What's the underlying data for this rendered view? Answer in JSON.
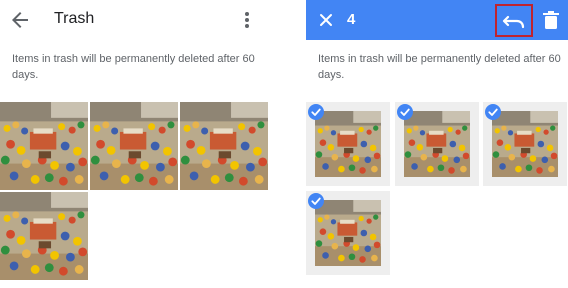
{
  "left": {
    "title": "Trash",
    "info": "Items in trash will be permanently deleted after 60 days.",
    "icons": {
      "back": "arrow-back-icon",
      "more": "more-vert-icon"
    },
    "photos": [
      {
        "name": "photo-1"
      },
      {
        "name": "photo-2"
      },
      {
        "name": "photo-3"
      },
      {
        "name": "photo-4"
      }
    ]
  },
  "right": {
    "selected_count": "4",
    "info": "Items in trash will be permanently deleted after 60 days.",
    "icons": {
      "close": "close-icon",
      "restore": "restore-icon",
      "delete": "delete-icon",
      "check": "check-circle-icon"
    },
    "photos": [
      {
        "name": "selected-photo-1",
        "selected": true
      },
      {
        "name": "selected-photo-2",
        "selected": true
      },
      {
        "name": "selected-photo-3",
        "selected": true
      },
      {
        "name": "selected-photo-4",
        "selected": true
      }
    ]
  },
  "colors": {
    "accent": "#4285f4",
    "highlight_border": "#c0232d",
    "text_primary": "#202124",
    "text_secondary": "#5f6368"
  }
}
